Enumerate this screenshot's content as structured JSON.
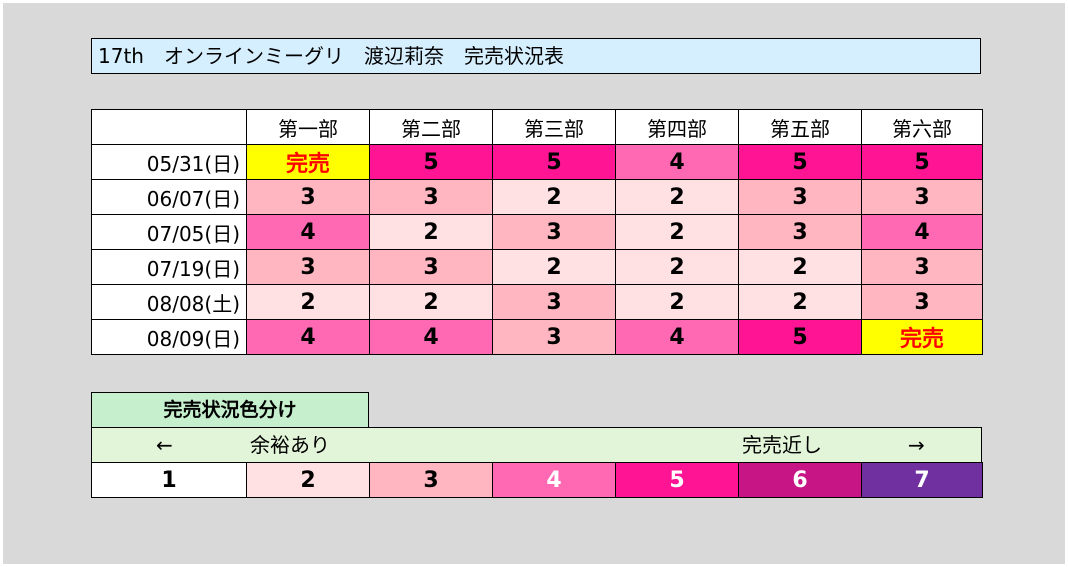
{
  "title": "17th　オンラインミーグリ　渡辺莉奈　完売状況表",
  "columns": [
    "第一部",
    "第二部",
    "第三部",
    "第四部",
    "第五部",
    "第六部"
  ],
  "rows": [
    {
      "date": "05/31(日)",
      "cells": [
        "完売",
        "5",
        "5",
        "4",
        "5",
        "5"
      ]
    },
    {
      "date": "06/07(日)",
      "cells": [
        "3",
        "3",
        "2",
        "2",
        "3",
        "3"
      ]
    },
    {
      "date": "07/05(日)",
      "cells": [
        "4",
        "2",
        "3",
        "2",
        "3",
        "4"
      ]
    },
    {
      "date": "07/19(日)",
      "cells": [
        "3",
        "3",
        "2",
        "2",
        "2",
        "3"
      ]
    },
    {
      "date": "08/08(土)",
      "cells": [
        "2",
        "2",
        "3",
        "2",
        "2",
        "3"
      ]
    },
    {
      "date": "08/09(日)",
      "cells": [
        "4",
        "4",
        "3",
        "4",
        "5",
        "完売"
      ]
    }
  ],
  "legend": {
    "title": "完売状況色分け",
    "left_arrow": "←",
    "left_label": "余裕あり",
    "right_label": "完売近し",
    "right_arrow": "→",
    "levels": [
      "1",
      "2",
      "3",
      "4",
      "5",
      "6",
      "7"
    ]
  },
  "colors": {
    "level_1": "#ffffff",
    "level_2": "#ffe0e3",
    "level_3": "#ffb6c1",
    "level_4": "#ff69b4",
    "level_5": "#ff1493",
    "level_6": "#c71585",
    "level_7": "#7030a0",
    "sold_out_bg": "#ffff00",
    "sold_out_text": "#ff0000",
    "title_bg": "#d6efff",
    "legend_title_bg": "#c6efce",
    "legend_bar_bg": "#e2f5d9"
  }
}
